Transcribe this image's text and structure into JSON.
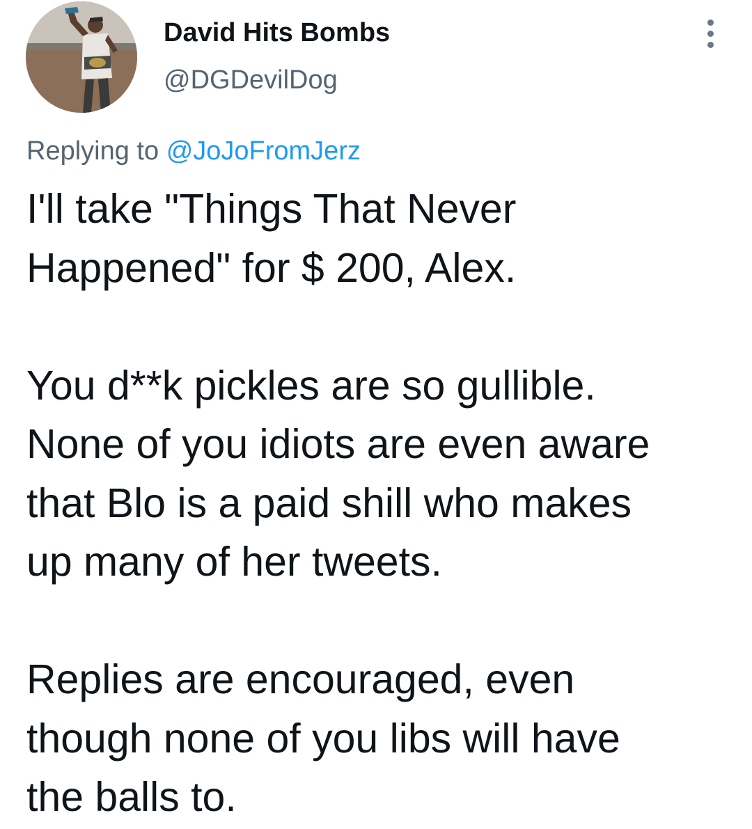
{
  "author": {
    "display_name": "David Hits Bombs",
    "handle": "@DGDevilDog"
  },
  "reply_context": {
    "prefix": "Replying to",
    "mention": "@JoJoFromJerz"
  },
  "tweet": {
    "paragraph_1": "I'll take \"Things That Never\nHappened\" for $ 200, Alex.",
    "paragraph_2": "You d**k pickles are so gullible.\nNone of you idiots are even aware\nthat Blo is a paid shill who makes\nup many of her tweets.",
    "paragraph_3": "Replies are encouraged, even\nthough none of you libs will have\nthe balls to."
  },
  "icons": {
    "more": "more-vertical-icon",
    "avatar": "profile-photo"
  },
  "colors": {
    "text_primary": "#0f1419",
    "text_secondary": "#536471",
    "link": "#1d9bf0",
    "background": "#ffffff"
  }
}
